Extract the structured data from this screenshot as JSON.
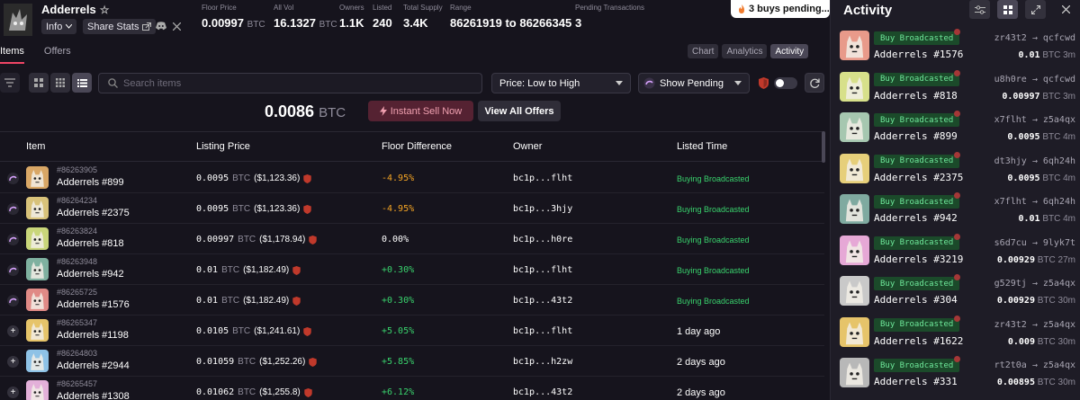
{
  "collection": {
    "name": "Adderrels",
    "info_label": "Info",
    "share_label": "Share Stats"
  },
  "stats": [
    {
      "label": "Floor Price",
      "value": "0.00997",
      "unit": "BTC"
    },
    {
      "label": "All Vol",
      "value": "16.1327",
      "unit": "BTC"
    },
    {
      "label": "Owners",
      "value": "1.1K",
      "unit": ""
    },
    {
      "label": "Listed",
      "value": "240",
      "unit": ""
    },
    {
      "label": "Total Supply",
      "value": "3.4K",
      "unit": ""
    },
    {
      "label": "Range",
      "value": "86261919 to 86266345",
      "unit": ""
    },
    {
      "label": "Pending Transactions",
      "value": "3",
      "unit": ""
    }
  ],
  "pending_pill": "3 buys pending...",
  "tabs": {
    "items": "Items",
    "offers": "Offers"
  },
  "view_tabs": {
    "chart": "Chart",
    "analytics": "Analytics",
    "activity": "Activity"
  },
  "search": {
    "placeholder": "Search items"
  },
  "sort": {
    "selected": "Price: Low to High"
  },
  "pending_filter": {
    "selected": "Show Pending"
  },
  "floor_display": {
    "value": "0.0086",
    "unit": "BTC"
  },
  "buttons": {
    "instant_sell": "Instant Sell Now",
    "view_all_offers": "View All Offers"
  },
  "table": {
    "headers": {
      "item": "Item",
      "price": "Listing Price",
      "diff": "Floor Difference",
      "owner": "Owner",
      "time": "Listed Time"
    },
    "rows": [
      {
        "status": "pending",
        "inscription": "#86263905",
        "name": "Adderrels #899",
        "price": "0.0095",
        "unit": "BTC",
        "usd": "($1,123.36)",
        "diff": "-4.95%",
        "diff_kind": "neg",
        "owner": "bc1p...flht",
        "time": "Buying Broadcasted",
        "color": "#d9a766"
      },
      {
        "status": "pending",
        "inscription": "#86264234",
        "name": "Adderrels #2375",
        "price": "0.0095",
        "unit": "BTC",
        "usd": "($1,123.36)",
        "diff": "-4.95%",
        "diff_kind": "neg",
        "owner": "bc1p...3hjy",
        "time": "Buying Broadcasted",
        "color": "#d8c27a"
      },
      {
        "status": "pending",
        "inscription": "#86263824",
        "name": "Adderrels #818",
        "price": "0.00997",
        "unit": "BTC",
        "usd": "($1,178.94)",
        "diff": "0.00%",
        "diff_kind": "zero",
        "owner": "bc1p...h0re",
        "time": "Buying Broadcasted",
        "color": "#c9d67a"
      },
      {
        "status": "pending",
        "inscription": "#86263948",
        "name": "Adderrels #942",
        "price": "0.01",
        "unit": "BTC",
        "usd": "($1,182.49)",
        "diff": "+0.30%",
        "diff_kind": "pos",
        "owner": "bc1p...flht",
        "time": "Buying Broadcasted",
        "color": "#7fb1a0"
      },
      {
        "status": "pending",
        "inscription": "#86265725",
        "name": "Adderrels #1576",
        "price": "0.01",
        "unit": "BTC",
        "usd": "($1,182.49)",
        "diff": "+0.30%",
        "diff_kind": "pos",
        "owner": "bc1p...43t2",
        "time": "Buying Broadcasted",
        "color": "#e08a86"
      },
      {
        "status": "add",
        "inscription": "#86265347",
        "name": "Adderrels #1198",
        "price": "0.0105",
        "unit": "BTC",
        "usd": "($1,241.61)",
        "diff": "+5.05%",
        "diff_kind": "pos",
        "owner": "bc1p...flht",
        "time": "1 day ago",
        "color": "#e6c46a"
      },
      {
        "status": "add",
        "inscription": "#86264803",
        "name": "Adderrels #2944",
        "price": "0.01059",
        "unit": "BTC",
        "usd": "($1,252.26)",
        "diff": "+5.85%",
        "diff_kind": "pos",
        "owner": "bc1p...h2zw",
        "time": "2 days ago",
        "color": "#8ec2e6"
      },
      {
        "status": "add",
        "inscription": "#86265457",
        "name": "Adderrels #1308",
        "price": "0.01062",
        "unit": "BTC",
        "usd": "($1,255.8)",
        "diff": "+6.12%",
        "diff_kind": "pos",
        "owner": "bc1p...43t2",
        "time": "2 days ago",
        "color": "#e3b0d9"
      }
    ]
  },
  "activity": {
    "title": "Activity",
    "items": [
      {
        "badge": "Buy Broadcasted",
        "name": "Adderrels #1576",
        "from": "zr43t2",
        "to": "qcfcwd",
        "amount": "0.01",
        "unit": "BTC",
        "age": "3m",
        "color": "#e89a8a"
      },
      {
        "badge": "Buy Broadcasted",
        "name": "Adderrels #818",
        "from": "u8h0re",
        "to": "qcfcwd",
        "amount": "0.00997",
        "unit": "BTC",
        "age": "3m",
        "color": "#d7e08a"
      },
      {
        "badge": "Buy Broadcasted",
        "name": "Adderrels #899",
        "from": "x7flht",
        "to": "z5a4qx",
        "amount": "0.0095",
        "unit": "BTC",
        "age": "4m",
        "color": "#a6c7b0"
      },
      {
        "badge": "Buy Broadcasted",
        "name": "Adderrels #2375",
        "from": "dt3hjy",
        "to": "6qh24h",
        "amount": "0.0095",
        "unit": "BTC",
        "age": "4m",
        "color": "#e6cf7a"
      },
      {
        "badge": "Buy Broadcasted",
        "name": "Adderrels #942",
        "from": "x7flht",
        "to": "6qh24h",
        "amount": "0.01",
        "unit": "BTC",
        "age": "4m",
        "color": "#7faaa0"
      },
      {
        "badge": "Buy Broadcasted",
        "name": "Adderrels #3219",
        "from": "s6d7cu",
        "to": "9lyk7t",
        "amount": "0.00929",
        "unit": "BTC",
        "age": "27m",
        "color": "#e6a8d6"
      },
      {
        "badge": "Buy Broadcasted",
        "name": "Adderrels #304",
        "from": "g529tj",
        "to": "z5a4qx",
        "amount": "0.00929",
        "unit": "BTC",
        "age": "30m",
        "color": "#c9c9c9"
      },
      {
        "badge": "Buy Broadcasted",
        "name": "Adderrels #1622",
        "from": "zr43t2",
        "to": "z5a4qx",
        "amount": "0.009",
        "unit": "BTC",
        "age": "30m",
        "color": "#e6c46a"
      },
      {
        "badge": "Buy Broadcasted",
        "name": "Adderrels #331",
        "from": "rt2t0a",
        "to": "z5a4qx",
        "amount": "0.00895",
        "unit": "BTC",
        "age": "30m",
        "color": "#b8b8b8"
      }
    ]
  }
}
